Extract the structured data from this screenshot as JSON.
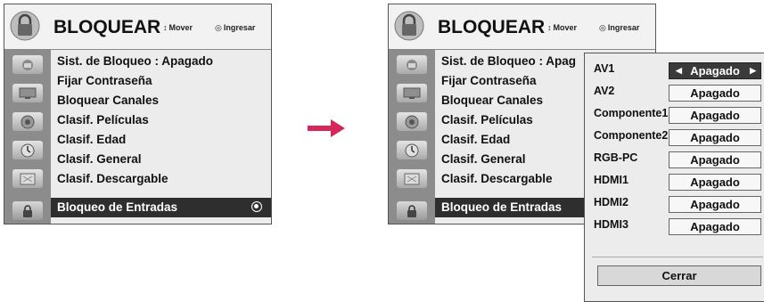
{
  "menu": {
    "title": "BLOQUEAR",
    "hint_move": "Mover",
    "hint_enter": "Ingresar",
    "items_left": [
      "Sist. de Bloqueo : Apagado",
      "Fijar Contraseña",
      "Bloquear Canales",
      "Clasif. Películas",
      "Clasif. Edad",
      "Clasif. General",
      "Clasif. Descargable",
      "Bloqueo de Entradas"
    ],
    "items_right": [
      "Sist. de Bloqueo : Apag",
      "Fijar Contraseña",
      "Bloquear Canales",
      "Clasif. Películas",
      "Clasif. Edad",
      "Clasif. General",
      "Clasif. Descargable",
      "Bloqueo de Entradas"
    ],
    "selected_index": 7,
    "sidebar_icons": [
      "picture-icon",
      "tv-icon",
      "speaker-icon",
      "clock-icon",
      "calendar-icon",
      "lock-icon"
    ]
  },
  "popup": {
    "rows": [
      {
        "label": "AV1",
        "value": "Apagado"
      },
      {
        "label": "AV2",
        "value": "Apagado"
      },
      {
        "label": "Componente1",
        "value": "Apagado"
      },
      {
        "label": "Componente2",
        "value": "Apagado"
      },
      {
        "label": "RGB-PC",
        "value": "Apagado"
      },
      {
        "label": "HDMI1",
        "value": "Apagado"
      },
      {
        "label": "HDMI2",
        "value": "Apagado"
      },
      {
        "label": "HDMI3",
        "value": "Apagado"
      }
    ],
    "close_label": "Cerrar"
  },
  "colors": {
    "arrow": "#d6265a",
    "highlight": "#2e2e2e",
    "sidebar": "#8c8c8c"
  }
}
